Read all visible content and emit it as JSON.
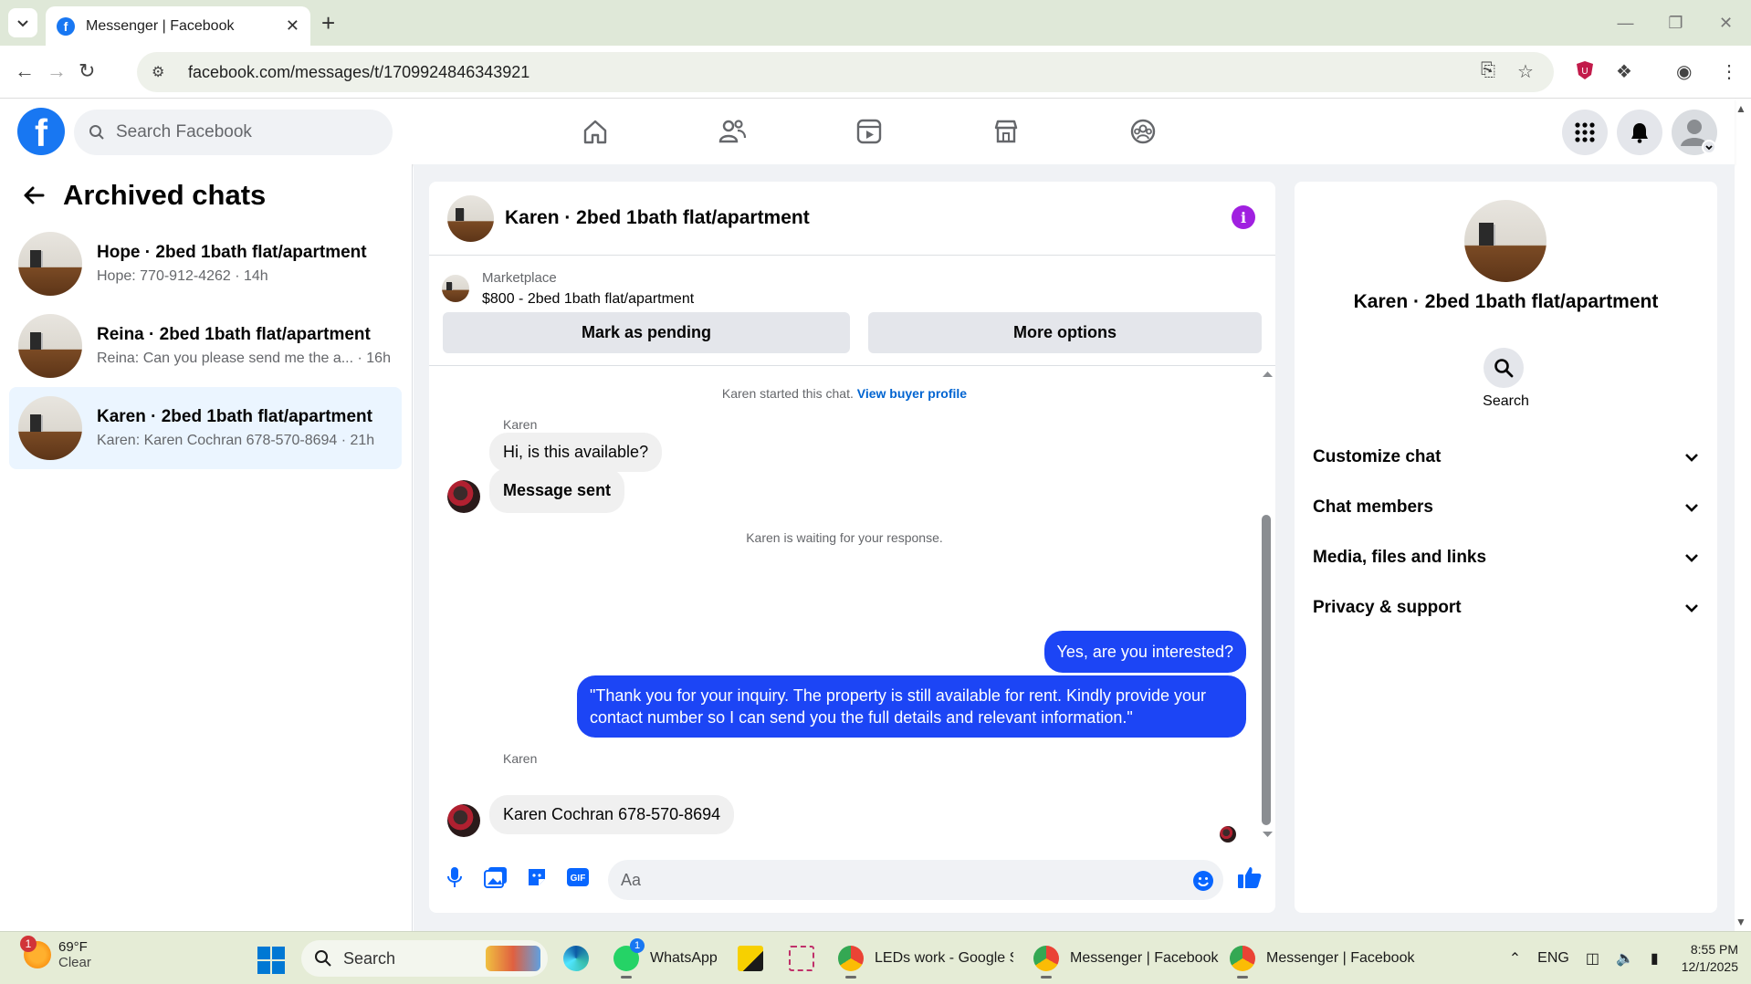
{
  "browser": {
    "tab_title": "Messenger | Facebook",
    "url": "facebook.com/messages/t/1709924846343921",
    "new_tab_symbol": "+",
    "close_symbol": "✕"
  },
  "fb": {
    "logo_letter": "f",
    "search_placeholder": "Search Facebook",
    "brand_color": "#1877f2"
  },
  "archived": {
    "title": "Archived chats",
    "chats": [
      {
        "name": "Hope · 2bed 1bath flat/apartment",
        "preview": "Hope: 770-912-4262 · 14h",
        "active": false
      },
      {
        "name": "Reina · 2bed 1bath flat/apartment",
        "preview": "Reina: Can you please send me the a... · 16h",
        "active": false
      },
      {
        "name": "Karen · 2bed 1bath flat/apartment",
        "preview": "Karen: Karen Cochran 678-570-8694 · 21h",
        "active": true
      }
    ]
  },
  "chat": {
    "title": "Karen · 2bed 1bath flat/apartment",
    "marketplace_label": "Marketplace",
    "listing": "$800 - 2bed 1bath flat/apartment",
    "mark_pending_label": "Mark as pending",
    "more_options_label": "More options",
    "started_note": "Karen started this chat.",
    "view_profile_link": "View buyer profile",
    "sender_name": "Karen",
    "msg_1": "Hi, is this available?",
    "msg_2": "Message sent",
    "waiting_note": "Karen is waiting for your response.",
    "out_1": "Yes, are you interested?",
    "out_2": "\"Thank you for your inquiry. The property is still available for rent. Kindly provide your contact number so I can send you the full details and relevant information.\"",
    "sender_name_2": "Karen",
    "msg_3": "Karen Cochran 678-570-8694",
    "composer_placeholder": "Aa",
    "outgoing_color": "#1c45f5"
  },
  "info_panel": {
    "name": "Karen · 2bed 1bath flat/apartment",
    "search_label": "Search",
    "rows": [
      "Customize chat",
      "Chat members",
      "Media, files and links",
      "Privacy & support"
    ]
  },
  "taskbar": {
    "weather_temp": "69°F",
    "weather_desc": "Clear",
    "weather_badge": "1",
    "search_label": "Search",
    "apps": [
      {
        "label": "WhatsApp"
      },
      {
        "label": "LEDs work - Google Sh"
      },
      {
        "label": "Messenger | Facebook"
      },
      {
        "label": "Messenger | Facebook"
      }
    ],
    "whatsapp_badge": "1",
    "lang": "ENG",
    "time": "8:55 PM",
    "date": "12/1/2025"
  }
}
